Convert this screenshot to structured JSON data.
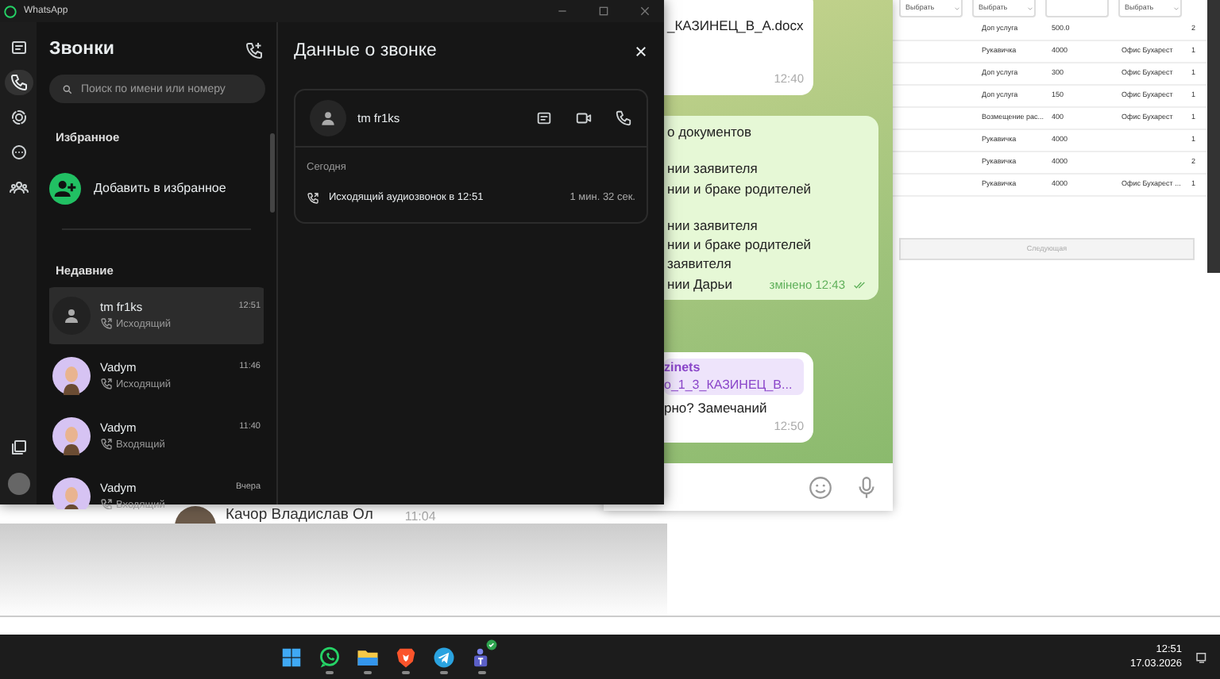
{
  "whatsapp": {
    "title": "WhatsApp",
    "nav_items": [
      {
        "kind": "chats",
        "selected": false
      },
      {
        "kind": "calls",
        "selected": true
      },
      {
        "kind": "status",
        "selected": false
      },
      {
        "kind": "channels",
        "selected": false
      },
      {
        "kind": "communities",
        "selected": false
      }
    ],
    "calls_panel": {
      "title": "Звонки",
      "search": {
        "placeholder": "Поиск по имени или номеру"
      },
      "favorites_heading": "Избранное",
      "add_favorite": "Добавить в избранное",
      "recent_heading": "Недавние",
      "calls": [
        {
          "name": "tm fr1ks",
          "time": "12:51",
          "direction": "Исходящий",
          "avatar_photo": false,
          "selected": true
        },
        {
          "name": "Vadym",
          "time": "11:46",
          "direction": "Исходящий",
          "avatar_photo": true,
          "selected": false
        },
        {
          "name": "Vadym",
          "time": "11:40",
          "direction": "Входящий",
          "avatar_photo": true,
          "selected": false
        },
        {
          "name": "Vadym",
          "time": "Вчера",
          "direction": "Входящий",
          "avatar_photo": true,
          "selected": false
        }
      ]
    },
    "details": {
      "title": "Данные о звонке",
      "contact": "tm fr1ks",
      "day": "Сегодня",
      "entry": "Исходящий аудиозвонок в 12:51",
      "duration": "1 мин. 32 сек."
    }
  },
  "telegram": {
    "messages": [
      {
        "kind": "incoming",
        "paragraphs": [
          [
            "_КАЗИНЕЦ_В_А.docx"
          ]
        ],
        "time": "12:40"
      },
      {
        "kind": "outgoing",
        "paragraphs": [
          [
            "о документов"
          ],
          [
            "нии заявителя",
            "нии и браке родителей"
          ],
          [
            "нии заявителя",
            "нии и браке родителей",
            "заявителя",
            "нии Дарьи"
          ]
        ],
        "time": "змінено 12:43",
        "read": true
      },
      {
        "kind": "incoming",
        "reply": [
          "zinets",
          "о_1_3_КАЗИНЕЦ_В..."
        ],
        "paragraphs": [
          [
            "рно? Замечаний"
          ]
        ],
        "time": "12:50"
      }
    ]
  },
  "web_table": {
    "filters": [
      {
        "kind": "select",
        "label": "Выбрать"
      },
      {
        "kind": "select",
        "label": "Выбрать"
      },
      {
        "kind": "input"
      },
      {
        "kind": "select",
        "label": "Выбрать"
      }
    ],
    "rows": [
      [
        "Доп услуга",
        "500.0",
        "",
        "2"
      ],
      [
        "Рукавичка",
        "4000",
        "Офис Бухарест",
        "1"
      ],
      [
        "Доп услуга",
        "300",
        "Офис Бухарест",
        "1"
      ],
      [
        "Доп услуга",
        "150",
        "Офис Бухарест",
        "1"
      ],
      [
        "Возмещение рас...",
        "400",
        "Офис Бухарест",
        "1"
      ],
      [
        "Рукавичка",
        "4000",
        "",
        "1"
      ],
      [
        "Рукавичка",
        "4000",
        "",
        "2"
      ],
      [
        "Рукавичка",
        "4000",
        "Офис Бухарест ...",
        "1"
      ]
    ],
    "next_button": {
      "label": "Следующая",
      "disabled": true
    }
  },
  "background_list": {
    "name": "Качор Владислав Ол",
    "time": "11:04"
  },
  "taskbar": {
    "apps": [
      {
        "kind": "start",
        "badge": false
      },
      {
        "kind": "whatsapp",
        "badge": false
      },
      {
        "kind": "folder",
        "badge": false
      },
      {
        "kind": "brave",
        "badge": false
      },
      {
        "kind": "telegram",
        "badge": false
      },
      {
        "kind": "teams",
        "badge": true
      }
    ],
    "time": "12:51",
    "date": "17.03.2026"
  }
}
